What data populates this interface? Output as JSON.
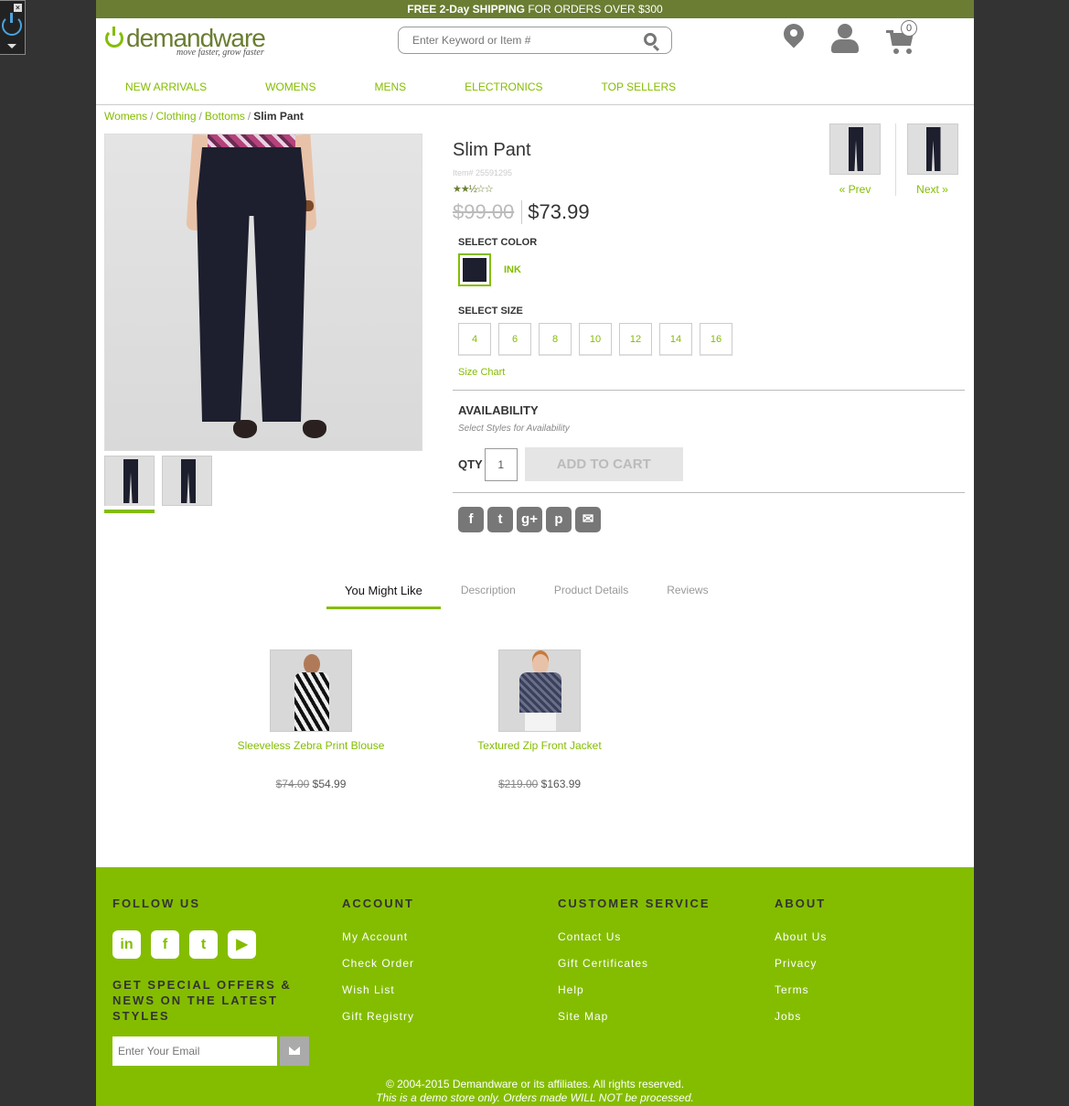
{
  "promo": {
    "bold": "FREE 2-Day SHIPPING",
    "rest": " FOR ORDERS OVER $300"
  },
  "brand": {
    "name": "demandware",
    "tagline": "move faster, grow faster"
  },
  "search": {
    "placeholder": "Enter Keyword or Item #"
  },
  "cart": {
    "count": "0"
  },
  "nav": [
    "NEW ARRIVALS",
    "WOMENS",
    "MENS",
    "ELECTRONICS",
    "TOP SELLERS"
  ],
  "breadcrumb": [
    "Womens",
    "Clothing",
    "Bottoms",
    "Slim Pant"
  ],
  "product": {
    "name": "Slim Pant",
    "item_no": "Item# 25591295",
    "rating_stars": "★★½☆☆",
    "rating": 2.5,
    "price_old": "$99.00",
    "price_new": "$73.99",
    "select_color_label": "SELECT COLOR",
    "color_name": "INK",
    "select_size_label": "SELECT SIZE",
    "sizes": [
      "4",
      "6",
      "8",
      "10",
      "12",
      "14",
      "16"
    ],
    "size_chart": "Size Chart",
    "availability_label": "AVAILABILITY",
    "availability_note": "Select Styles for Availability",
    "qty_label": "QTY",
    "qty_value": "1",
    "add_to_cart": "ADD TO CART",
    "prev": "« Prev",
    "next": "Next »"
  },
  "share_icons": [
    "facebook-icon",
    "twitter-icon",
    "google-plus-icon",
    "pinterest-icon",
    "email-icon"
  ],
  "tabs": [
    "You Might Like",
    "Description",
    "Product Details",
    "Reviews"
  ],
  "recommendations": [
    {
      "name": "Sleeveless Zebra Print Blouse",
      "price_old": "$74.00",
      "price_new": "$54.99"
    },
    {
      "name": "Textured Zip Front Jacket",
      "price_old": "$219.00",
      "price_new": "$163.99"
    }
  ],
  "footer": {
    "follow_us": "FOLLOW US",
    "social": [
      "linkedin-icon",
      "facebook-icon",
      "twitter-icon",
      "youtube-icon"
    ],
    "offers_text": "GET SPECIAL OFFERS & NEWS ON THE LATEST STYLES",
    "email_placeholder": "Enter Your Email",
    "account": {
      "title": "ACCOUNT",
      "links": [
        "My Account",
        "Check Order",
        "Wish List",
        "Gift Registry"
      ]
    },
    "customer_service": {
      "title": "CUSTOMER SERVICE",
      "links": [
        "Contact Us",
        "Gift Certificates",
        "Help",
        "Site Map"
      ]
    },
    "about": {
      "title": "ABOUT",
      "links": [
        "About Us",
        "Privacy",
        "Terms",
        "Jobs"
      ]
    },
    "copyright": "© 2004-2015 Demandware or its affiliates. All rights reserved.",
    "demo_note": "This is a demo store only. Orders made WILL NOT be processed."
  },
  "colors": {
    "accent": "#84bd00",
    "promo_bar": "#6a7d32",
    "background": "#333333"
  }
}
